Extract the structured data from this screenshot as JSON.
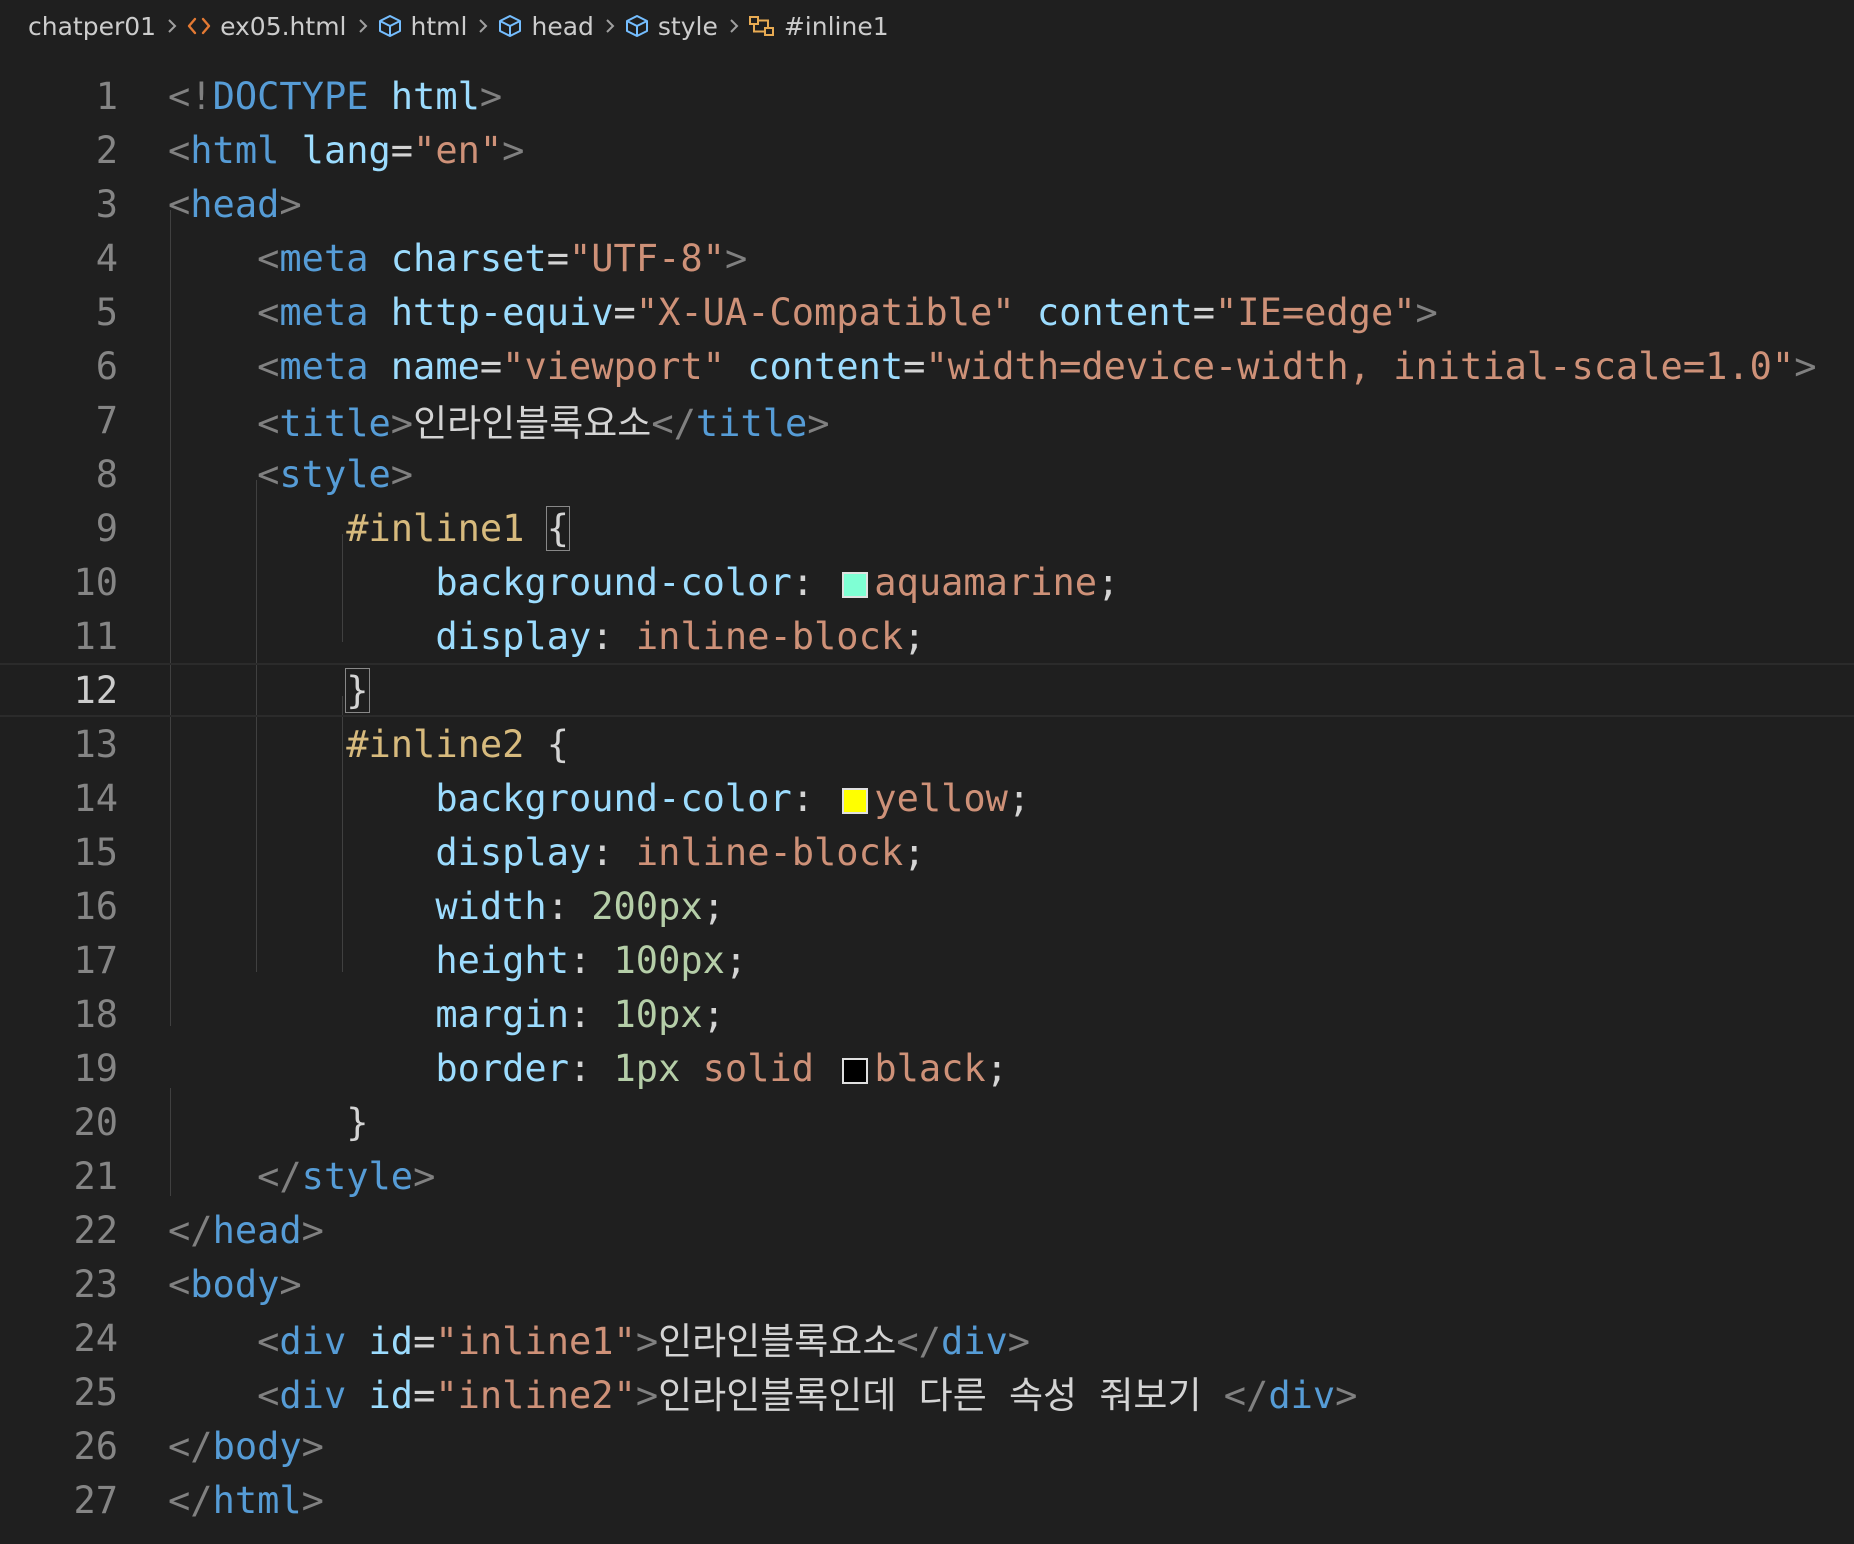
{
  "breadcrumb": {
    "items": [
      {
        "label": "chatper01",
        "icon": ""
      },
      {
        "label": "ex05.html",
        "icon": "html-file-icon"
      },
      {
        "label": "html",
        "icon": "cube-icon"
      },
      {
        "label": "head",
        "icon": "cube-icon"
      },
      {
        "label": "style",
        "icon": "cube-icon"
      },
      {
        "label": "#inline1",
        "icon": "selector-icon"
      }
    ]
  },
  "editor": {
    "current_line": 12,
    "swatches": {
      "aquamarine": "#7fffd4",
      "yellow": "#ffff00",
      "black": "#000000"
    },
    "lines": [
      {
        "n": "1",
        "tokens": [
          [
            "punct",
            "<!"
          ],
          [
            "tag",
            "DOCTYPE"
          ],
          [
            "text",
            " "
          ],
          [
            "attr",
            "html"
          ],
          [
            "punct",
            ">"
          ]
        ]
      },
      {
        "n": "2",
        "tokens": [
          [
            "punct",
            "<"
          ],
          [
            "tag",
            "html"
          ],
          [
            "text",
            " "
          ],
          [
            "attr",
            "lang"
          ],
          [
            "text",
            "="
          ],
          [
            "str",
            "\"en\""
          ],
          [
            "punct",
            ">"
          ]
        ]
      },
      {
        "n": "3",
        "tokens": [
          [
            "punct",
            "<"
          ],
          [
            "tag",
            "head"
          ],
          [
            "punct",
            ">"
          ]
        ]
      },
      {
        "n": "4",
        "tokens": [
          [
            "text",
            "    "
          ],
          [
            "punct",
            "<"
          ],
          [
            "tag",
            "meta"
          ],
          [
            "text",
            " "
          ],
          [
            "attr",
            "charset"
          ],
          [
            "text",
            "="
          ],
          [
            "str",
            "\"UTF-8\""
          ],
          [
            "punct",
            ">"
          ]
        ]
      },
      {
        "n": "5",
        "tokens": [
          [
            "text",
            "    "
          ],
          [
            "punct",
            "<"
          ],
          [
            "tag",
            "meta"
          ],
          [
            "text",
            " "
          ],
          [
            "attr",
            "http-equiv"
          ],
          [
            "text",
            "="
          ],
          [
            "str",
            "\"X-UA-Compatible\""
          ],
          [
            "text",
            " "
          ],
          [
            "attr",
            "content"
          ],
          [
            "text",
            "="
          ],
          [
            "str",
            "\"IE=edge\""
          ],
          [
            "punct",
            ">"
          ]
        ]
      },
      {
        "n": "6",
        "tokens": [
          [
            "text",
            "    "
          ],
          [
            "punct",
            "<"
          ],
          [
            "tag",
            "meta"
          ],
          [
            "text",
            " "
          ],
          [
            "attr",
            "name"
          ],
          [
            "text",
            "="
          ],
          [
            "str",
            "\"viewport\""
          ],
          [
            "text",
            " "
          ],
          [
            "attr",
            "content"
          ],
          [
            "text",
            "="
          ],
          [
            "str",
            "\"width=device-width, initial-scale=1.0\""
          ],
          [
            "punct",
            ">"
          ]
        ]
      },
      {
        "n": "7",
        "tokens": [
          [
            "text",
            "    "
          ],
          [
            "punct",
            "<"
          ],
          [
            "tag",
            "title"
          ],
          [
            "punct",
            ">"
          ],
          [
            "text",
            "인라인블록요소"
          ],
          [
            "punct",
            "</"
          ],
          [
            "tag",
            "title"
          ],
          [
            "punct",
            ">"
          ]
        ]
      },
      {
        "n": "8",
        "tokens": [
          [
            "text",
            "    "
          ],
          [
            "punct",
            "<"
          ],
          [
            "tag",
            "style"
          ],
          [
            "punct",
            ">"
          ]
        ]
      },
      {
        "n": "9",
        "tokens": [
          [
            "text",
            "        "
          ],
          [
            "sel",
            "#inline1"
          ],
          [
            "text",
            " "
          ],
          [
            "brace",
            "{"
          ]
        ]
      },
      {
        "n": "10",
        "tokens": [
          [
            "text",
            "            "
          ],
          [
            "prop",
            "background-color"
          ],
          [
            "text",
            ": "
          ],
          [
            "swatch",
            "aquamarine"
          ],
          [
            "val",
            "aquamarine"
          ],
          [
            "text",
            ";"
          ]
        ]
      },
      {
        "n": "11",
        "tokens": [
          [
            "text",
            "            "
          ],
          [
            "prop",
            "display"
          ],
          [
            "text",
            ": "
          ],
          [
            "val",
            "inline-block"
          ],
          [
            "text",
            ";"
          ]
        ]
      },
      {
        "n": "12",
        "tokens": [
          [
            "text",
            "        "
          ],
          [
            "brace",
            "}"
          ]
        ]
      },
      {
        "n": "13",
        "tokens": [
          [
            "text",
            "        "
          ],
          [
            "sel",
            "#inline2"
          ],
          [
            "text",
            " "
          ],
          [
            "brace",
            "{"
          ]
        ]
      },
      {
        "n": "14",
        "tokens": [
          [
            "text",
            "            "
          ],
          [
            "prop",
            "background-color"
          ],
          [
            "text",
            ": "
          ],
          [
            "swatch",
            "yellow"
          ],
          [
            "val",
            "yellow"
          ],
          [
            "text",
            ";"
          ]
        ]
      },
      {
        "n": "15",
        "tokens": [
          [
            "text",
            "            "
          ],
          [
            "prop",
            "display"
          ],
          [
            "text",
            ": "
          ],
          [
            "val",
            "inline-block"
          ],
          [
            "text",
            ";"
          ]
        ]
      },
      {
        "n": "16",
        "tokens": [
          [
            "text",
            "            "
          ],
          [
            "prop",
            "width"
          ],
          [
            "text",
            ": "
          ],
          [
            "num",
            "200px"
          ],
          [
            "text",
            ";"
          ]
        ]
      },
      {
        "n": "17",
        "tokens": [
          [
            "text",
            "            "
          ],
          [
            "prop",
            "height"
          ],
          [
            "text",
            ": "
          ],
          [
            "num",
            "100px"
          ],
          [
            "text",
            ";"
          ]
        ]
      },
      {
        "n": "18",
        "tokens": [
          [
            "text",
            "            "
          ],
          [
            "prop",
            "margin"
          ],
          [
            "text",
            ": "
          ],
          [
            "num",
            "10px"
          ],
          [
            "text",
            ";"
          ]
        ]
      },
      {
        "n": "19",
        "tokens": [
          [
            "text",
            "            "
          ],
          [
            "prop",
            "border"
          ],
          [
            "text",
            ": "
          ],
          [
            "num",
            "1px"
          ],
          [
            "text",
            " "
          ],
          [
            "val",
            "solid"
          ],
          [
            "text",
            " "
          ],
          [
            "swatch",
            "black"
          ],
          [
            "val",
            "black"
          ],
          [
            "text",
            ";"
          ]
        ]
      },
      {
        "n": "20",
        "tokens": [
          [
            "text",
            "        "
          ],
          [
            "brace",
            "}"
          ]
        ]
      },
      {
        "n": "21",
        "tokens": [
          [
            "text",
            "    "
          ],
          [
            "punct",
            "</"
          ],
          [
            "tag",
            "style"
          ],
          [
            "punct",
            ">"
          ]
        ]
      },
      {
        "n": "22",
        "tokens": [
          [
            "punct",
            "</"
          ],
          [
            "tag",
            "head"
          ],
          [
            "punct",
            ">"
          ]
        ]
      },
      {
        "n": "23",
        "tokens": [
          [
            "punct",
            "<"
          ],
          [
            "tag",
            "body"
          ],
          [
            "punct",
            ">"
          ]
        ]
      },
      {
        "n": "24",
        "tokens": [
          [
            "text",
            "    "
          ],
          [
            "punct",
            "<"
          ],
          [
            "tag",
            "div"
          ],
          [
            "text",
            " "
          ],
          [
            "attr",
            "id"
          ],
          [
            "text",
            "="
          ],
          [
            "str",
            "\"inline1\""
          ],
          [
            "punct",
            ">"
          ],
          [
            "text",
            "인라인블록요소"
          ],
          [
            "punct",
            "</"
          ],
          [
            "tag",
            "div"
          ],
          [
            "punct",
            ">"
          ]
        ]
      },
      {
        "n": "25",
        "tokens": [
          [
            "text",
            "    "
          ],
          [
            "punct",
            "<"
          ],
          [
            "tag",
            "div"
          ],
          [
            "text",
            " "
          ],
          [
            "attr",
            "id"
          ],
          [
            "text",
            "="
          ],
          [
            "str",
            "\"inline2\""
          ],
          [
            "punct",
            ">"
          ],
          [
            "text",
            "인라인블록인데 다른 속성 줘보기 "
          ],
          [
            "punct",
            "</"
          ],
          [
            "tag",
            "div"
          ],
          [
            "punct",
            ">"
          ]
        ]
      },
      {
        "n": "26",
        "tokens": [
          [
            "punct",
            "</"
          ],
          [
            "tag",
            "body"
          ],
          [
            "punct",
            ">"
          ]
        ]
      },
      {
        "n": "27",
        "tokens": [
          [
            "punct",
            "</"
          ],
          [
            "tag",
            "html"
          ],
          [
            "punct",
            ">"
          ]
        ]
      }
    ]
  }
}
